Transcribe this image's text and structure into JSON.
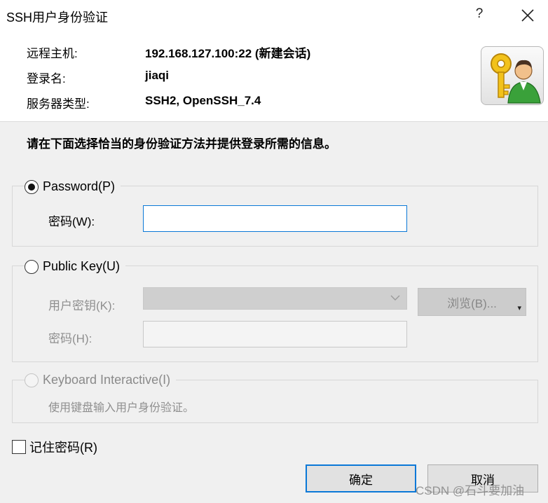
{
  "window": {
    "title": "SSH用户身份验证",
    "help_glyph": "?",
    "close_icon": "close-icon"
  },
  "info": [
    {
      "label": "远程主机:",
      "value": "192.168.127.100:22 (新建会话)"
    },
    {
      "label": "登录名:",
      "value": "jiaqi"
    },
    {
      "label": "服务器类型:",
      "value": "SSH2, OpenSSH_7.4"
    }
  ],
  "logo_icon": "key-user-icon",
  "prompt": "请在下面选择恰当的身份验证方法并提供登录所需的信息。",
  "password_section": {
    "option_label": "Password(P)",
    "selected": true,
    "field_label": "密码(W):",
    "field_value": ""
  },
  "publickey_section": {
    "option_label": "Public Key(U)",
    "selected": false,
    "key_label": "用户密钥(K):",
    "key_value": "",
    "browse_label": "浏览(B)...",
    "passphrase_label": "密码(H):",
    "passphrase_value": ""
  },
  "keyboard_section": {
    "option_label": "Keyboard Interactive(I)",
    "selected": false,
    "disabled": true,
    "hint": "使用键盘输入用户身份验证。"
  },
  "remember": {
    "label": "记住密码(R)",
    "checked": false
  },
  "buttons": {
    "ok": "确定",
    "cancel": "取消"
  },
  "watermark": "CSDN @石斗要加油",
  "colors": {
    "accent": "#0a78d7",
    "background": "#f0f0f0",
    "header_bg": "#ffffff",
    "disabled_text": "#8f8f8f"
  }
}
